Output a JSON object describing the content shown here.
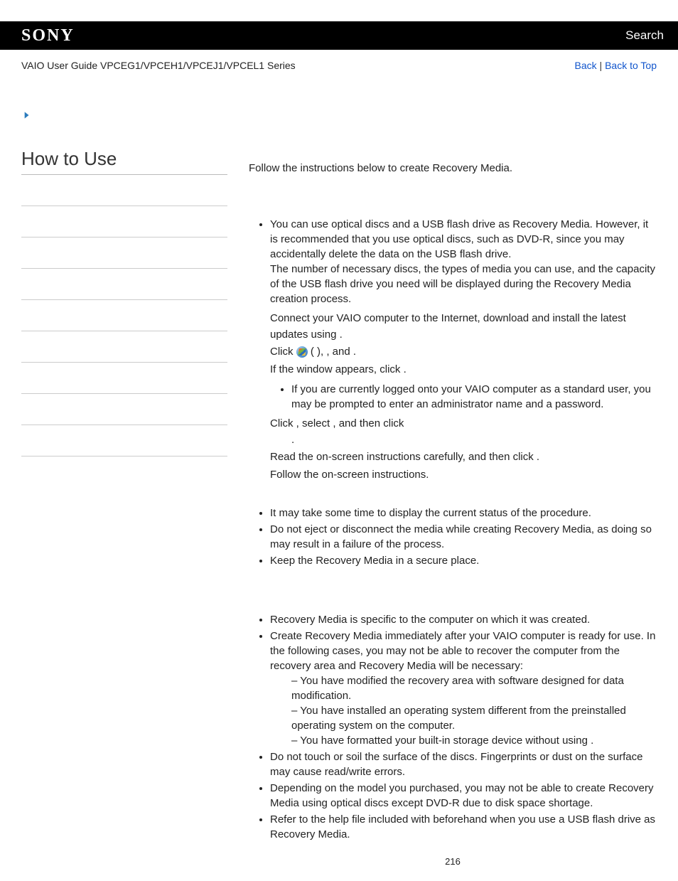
{
  "header": {
    "logo": "SONY",
    "search": "Search"
  },
  "subheader": {
    "title": "VAIO User Guide VPCEG1/VPCEH1/VPCEJ1/VPCEL1 Series",
    "back": "Back",
    "sep": " | ",
    "top": "Back to Top"
  },
  "left": {
    "heading": "How to Use"
  },
  "main": {
    "intro": "Follow the instructions below to create Recovery Media.",
    "tip1a": "You can use optical discs and a USB flash drive as Recovery Media. However, it is recommended that you use optical discs, such as DVD-R, since you may accidentally delete the data on the USB flash drive.",
    "tip1b": "The number of necessary discs, the types of media you can use, and the capacity of the USB flash drive you need will be displayed during the Recovery Media creation process.",
    "step1a": "Connect your VAIO computer to the Internet, download and install the latest updates using ",
    "step1b": ".",
    "step2a": "Click ",
    "step2b": " (          ), ",
    "step2c": ", and ",
    "step2d": ".",
    "step3a": "If the ",
    "step3b": " window appears, click ",
    "step3c": ".",
    "substep": "If you are currently logged onto your VAIO computer as a standard user, you may be prompted to enter an administrator name and a password.",
    "step4a": "Click ",
    "step4b": ", select ",
    "step4c": ", and then click ",
    "step4d": ".",
    "step5a": "Read the on-screen instructions carefully, and then click ",
    "step5b": ".",
    "step6": "Follow the on-screen instructions.",
    "notes2": {
      "n1": "It may take some time to display the current status of the procedure.",
      "n2": "Do not eject or disconnect the media while creating Recovery Media, as doing so may result in a failure of the process.",
      "n3": "Keep the Recovery Media in a secure place."
    },
    "notes3": {
      "n1": "Recovery Media is specific to the computer on which it was created.",
      "n2": "Create Recovery Media immediately after your VAIO computer is ready for use. In the following cases, you may not be able to recover the computer from the recovery area and Recovery Media will be necessary:",
      "d1": "You have modified the recovery area with software designed for data modification.",
      "d2": "You have installed an operating system different from the preinstalled operating system on the computer.",
      "d3a": "You have formatted your built-in storage device without using ",
      "d3b": ".",
      "n3": "Do not touch or soil the surface of the discs. Fingerprints or dust on the surface may cause read/write errors.",
      "n4": "Depending on the model you purchased, you may not be able to create Recovery Media using optical discs except DVD-R due to disk space shortage.",
      "n5a": "Refer to the help file included with ",
      "n5b": " beforehand when you use a USB flash drive as Recovery Media."
    }
  },
  "pagenum": "216"
}
